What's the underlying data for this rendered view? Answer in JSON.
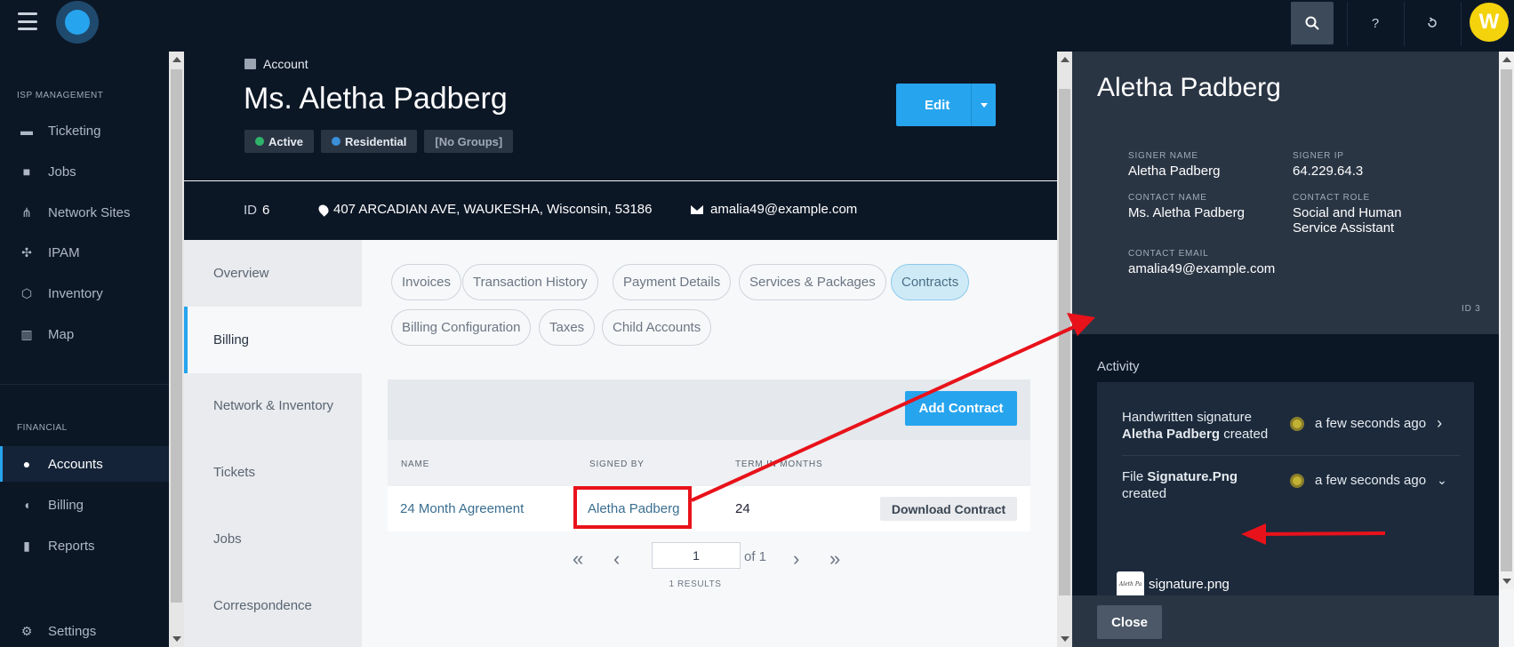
{
  "topbar": {
    "search_icon": "search-icon",
    "help_label": "?",
    "history_icon": "history-icon",
    "avatar_initial": "W"
  },
  "sidebar": {
    "section_isp": "ISP MANAGEMENT",
    "section_financial": "FINANCIAL",
    "items": [
      {
        "label": "Ticketing",
        "icon": "ticket-icon"
      },
      {
        "label": "Jobs",
        "icon": "briefcase-icon"
      },
      {
        "label": "Network Sites",
        "icon": "network-icon"
      },
      {
        "label": "IPAM",
        "icon": "ipam-icon"
      },
      {
        "label": "Inventory",
        "icon": "box-icon"
      },
      {
        "label": "Map",
        "icon": "map-icon"
      },
      {
        "label": "Accounts",
        "icon": "users-icon"
      },
      {
        "label": "Billing",
        "icon": "piggy-bank-icon"
      },
      {
        "label": "Reports",
        "icon": "bar-chart-icon"
      },
      {
        "label": "Settings",
        "icon": "gear-icon"
      }
    ]
  },
  "account": {
    "label": "Account",
    "name": "Ms. Aletha Padberg",
    "badges": [
      {
        "label": "Active",
        "color": "#2fb36b"
      },
      {
        "label": "Residential",
        "color": "#3a8fd8"
      },
      {
        "label": "[No Groups]"
      }
    ],
    "edit_label": "Edit",
    "id_label": "ID",
    "id_value": "6",
    "address": "407 ARCADIAN AVE, WAUKESHA, Wisconsin, 53186",
    "email": "amalia49@example.com"
  },
  "side_tabs": [
    "Overview",
    "Billing",
    "Network & Inventory",
    "Tickets",
    "Jobs",
    "Correspondence"
  ],
  "billing_tabs": [
    "Invoices",
    "Transaction History",
    "Payment Details",
    "Services & Packages",
    "Contracts",
    "Billing Configuration",
    "Taxes",
    "Child Accounts"
  ],
  "contracts": {
    "add_label": "Add Contract",
    "columns": [
      "NAME",
      "SIGNED BY",
      "TERM IN MONTHS"
    ],
    "rows": [
      {
        "name": "24 Month Agreement",
        "signed_by": "Aletha Padberg",
        "term": "24",
        "download_label": "Download Contract"
      }
    ]
  },
  "pager": {
    "first": "«",
    "prev": "‹",
    "next": "›",
    "last": "»",
    "page": "1",
    "of_label": "of 1",
    "results": "1 RESULTS"
  },
  "panel": {
    "title": "Aletha Padberg",
    "signer_name_label": "SIGNER NAME",
    "signer_name": "Aletha Padberg",
    "signer_ip_label": "SIGNER IP",
    "signer_ip": "64.229.64.3",
    "contact_name_label": "CONTACT NAME",
    "contact_name": "Ms. Aletha Padberg",
    "contact_role_label": "CONTACT ROLE",
    "contact_role": "Social and Human Service Assistant",
    "contact_email_label": "CONTACT EMAIL",
    "contact_email": "amalia49@example.com",
    "id_text": "ID 3",
    "activity_heading": "Activity",
    "activities": [
      {
        "text_pre": "Handwritten signature",
        "bold": "Aletha Padberg",
        "text_post": "created",
        "time": "a few seconds ago",
        "chevron": "›"
      },
      {
        "text_pre": "File",
        "bold": "Signature.Png",
        "text_post": "created",
        "time": "a few seconds ago",
        "chevron": "⌄"
      }
    ],
    "file_name": "signature.png",
    "file_thumb_text": "Aleth Pa",
    "close_label": "Close"
  },
  "colors": {
    "brand": "#27a4ee",
    "dark": "#0c1726",
    "annotation": "#e8121a"
  }
}
